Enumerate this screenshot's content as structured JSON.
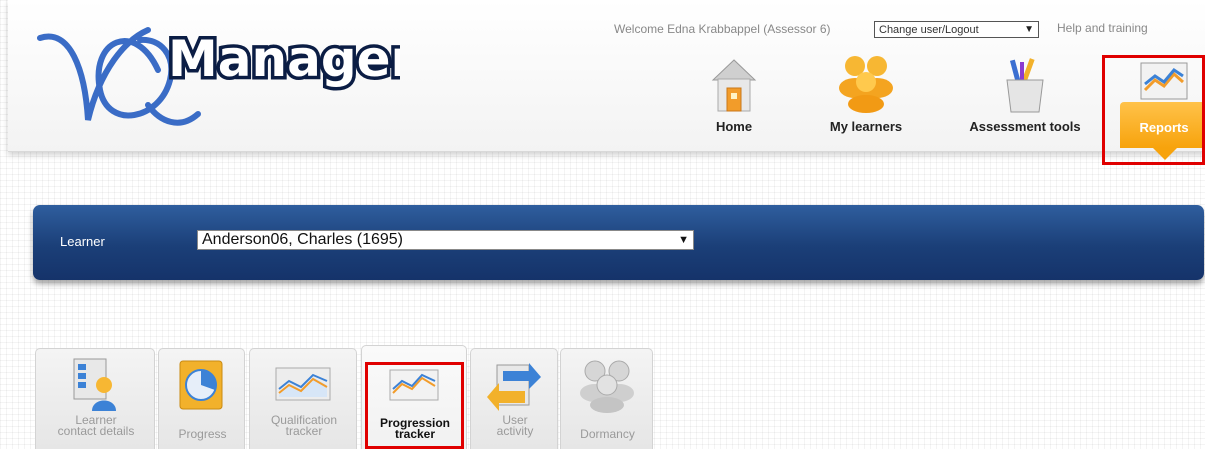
{
  "header": {
    "welcome_text": "Welcome Edna Krabbappel (Assessor 6)",
    "user_menu": {
      "selected": "Change user/Logout",
      "arrow": "▼"
    },
    "help_link": "Help and training",
    "logo_text": "VQManager"
  },
  "nav": {
    "items": [
      {
        "label": "Home",
        "icon": "home-icon"
      },
      {
        "label": "My learners",
        "icon": "learners-icon"
      },
      {
        "label": "Assessment tools",
        "icon": "tools-icon"
      },
      {
        "label": "Reports",
        "icon": "reports-chart-icon",
        "active": true
      }
    ]
  },
  "learner_bar": {
    "label": "Learner",
    "selected": "Anderson06, Charles (1695)",
    "arrow": "▼"
  },
  "report_tabs": [
    {
      "line1": "Learner",
      "line2": "contact details",
      "icon": "contact-card-icon"
    },
    {
      "line1": "Progress",
      "line2": "",
      "icon": "pie-chart-icon"
    },
    {
      "line1": "Qualification",
      "line2": "tracker",
      "icon": "line-chart-icon"
    },
    {
      "line1": "Progression",
      "line2": "tracker",
      "icon": "line-chart-icon",
      "active": true
    },
    {
      "line1": "User",
      "line2": "activity",
      "icon": "exchange-arrows-icon"
    },
    {
      "line1": "Dormancy",
      "line2": "",
      "icon": "people-icon"
    }
  ],
  "colors": {
    "header_bar": "#1b3f78",
    "reports_tab": "#f7a30c",
    "highlight": "#e00000"
  }
}
